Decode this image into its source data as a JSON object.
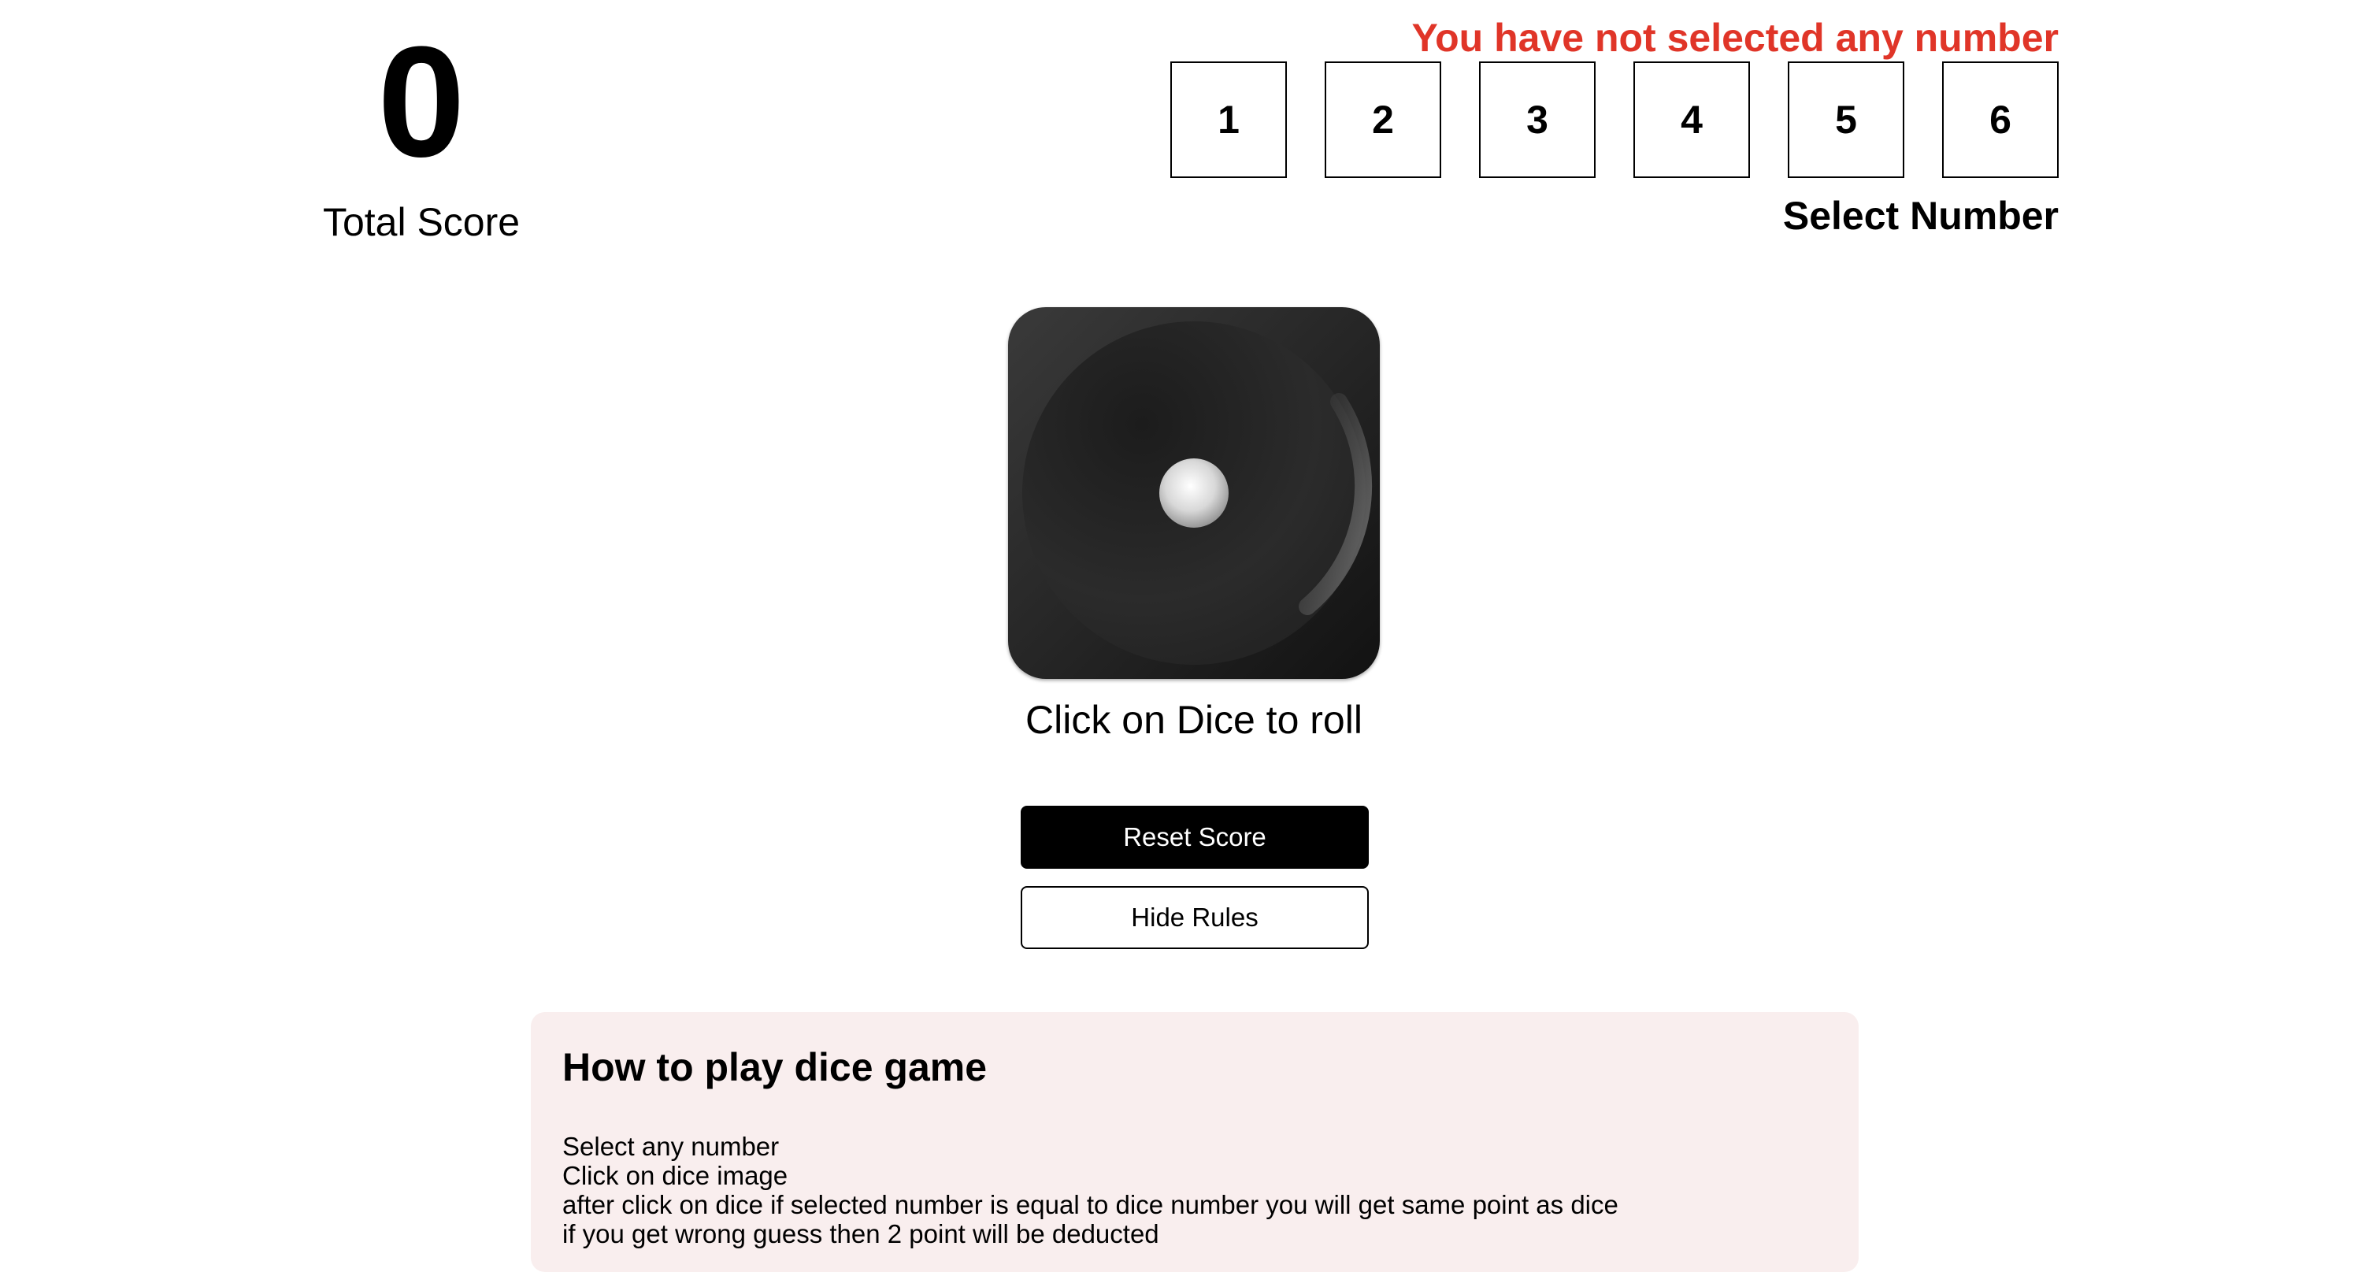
{
  "score": {
    "value": "0",
    "label": "Total Score"
  },
  "selector": {
    "error": "You have not selected any number",
    "numbers": [
      "1",
      "2",
      "3",
      "4",
      "5",
      "6"
    ],
    "label": "Select Number",
    "error_color": "#e03528"
  },
  "dice": {
    "face": 1,
    "icon": "dice-face-one-icon",
    "caption": "Click on Dice to roll"
  },
  "buttons": {
    "reset": "Reset Score",
    "rules": "Hide Rules"
  },
  "rules": {
    "title": "How to play dice game",
    "items": [
      "Select any number",
      "Click on dice image",
      "after click on dice if selected number is equal to dice number you will get same point as dice",
      "if you get wrong guess then 2 point will be deducted"
    ],
    "background": "#f9eeee"
  }
}
